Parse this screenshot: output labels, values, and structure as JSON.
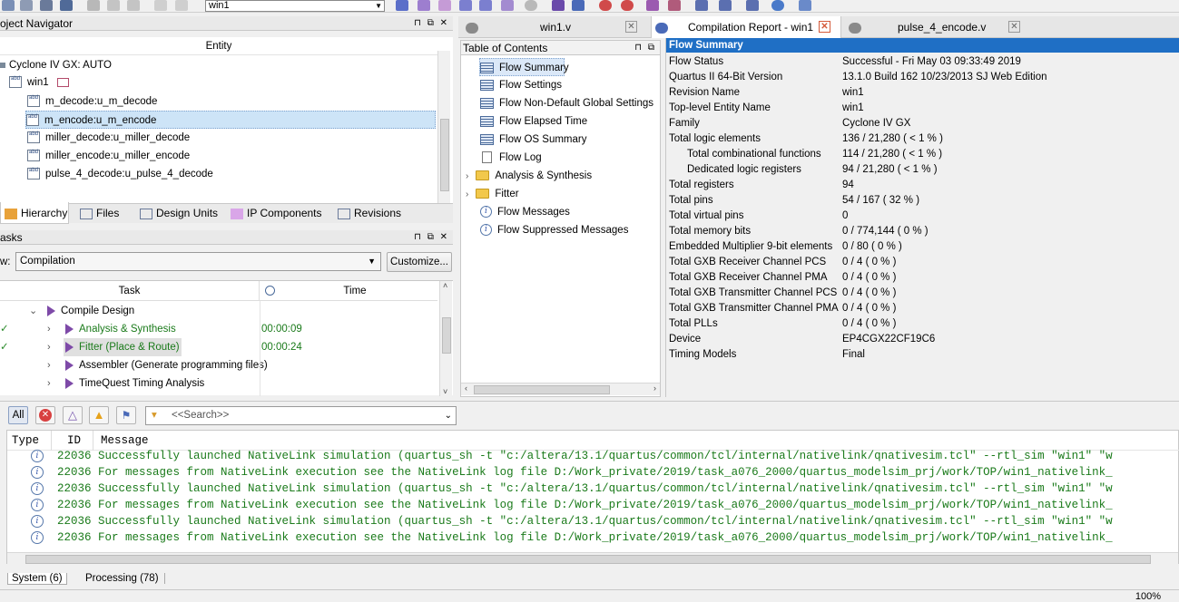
{
  "toolbar": {
    "revision_combo": "win1"
  },
  "project_navigator": {
    "title": "oject Navigator",
    "column_entity": "Entity",
    "device": "Cyclone IV GX: AUTO",
    "top_entity": "win1",
    "items": [
      {
        "label": "m_decode:u_m_decode"
      },
      {
        "label": "m_encode:u_m_encode"
      },
      {
        "label": "miller_decode:u_miller_decode"
      },
      {
        "label": "miller_encode:u_miller_encode"
      },
      {
        "label": "pulse_4_decode:u_pulse_4_decode"
      }
    ],
    "tabs": [
      "Hierarchy",
      "Files",
      "Design Units",
      "IP Components",
      "Revisions"
    ]
  },
  "tasks": {
    "title": "asks",
    "flow_label": "w:",
    "flow_value": "Compilation",
    "customize_label": "Customize...",
    "col_task": "Task",
    "col_time": "Time",
    "rows": [
      {
        "label": "Compile Design",
        "time": ""
      },
      {
        "label": "Analysis & Synthesis",
        "time": "00:00:09"
      },
      {
        "label": "Fitter (Place & Route)",
        "time": "00:00:24"
      },
      {
        "label": "Assembler (Generate programming files)",
        "time": ""
      },
      {
        "label": "TimeQuest Timing Analysis",
        "time": ""
      }
    ]
  },
  "editor_tabs": [
    {
      "label": "win1.v"
    },
    {
      "label": "Compilation Report - win1"
    },
    {
      "label": "pulse_4_encode.v"
    }
  ],
  "toc": {
    "title": "Table of Contents",
    "items": [
      {
        "label": "Flow Summary"
      },
      {
        "label": "Flow Settings"
      },
      {
        "label": "Flow Non-Default Global Settings"
      },
      {
        "label": "Flow Elapsed Time"
      },
      {
        "label": "Flow OS Summary"
      },
      {
        "label": "Flow Log"
      },
      {
        "label": "Analysis & Synthesis"
      },
      {
        "label": "Fitter"
      },
      {
        "label": "Flow Messages"
      },
      {
        "label": "Flow Suppressed Messages"
      }
    ]
  },
  "flow_summary": {
    "title": "Flow Summary",
    "rows": [
      {
        "key": "Flow Status",
        "value": "Successful - Fri May 03 09:33:49 2019"
      },
      {
        "key": "Quartus II 64-Bit Version",
        "value": "13.1.0 Build 162 10/23/2013 SJ Web Edition"
      },
      {
        "key": "Revision Name",
        "value": "win1"
      },
      {
        "key": "Top-level Entity Name",
        "value": "win1"
      },
      {
        "key": "Family",
        "value": "Cyclone IV GX"
      },
      {
        "key": "Total logic elements",
        "value": "136 / 21,280 ( < 1 % )"
      },
      {
        "key": "Total combinational functions",
        "value": "114 / 21,280 ( < 1 % )"
      },
      {
        "key": "Dedicated logic registers",
        "value": "94 / 21,280 ( < 1 % )"
      },
      {
        "key": "Total registers",
        "value": "94"
      },
      {
        "key": "Total pins",
        "value": "54 / 167 ( 32 % )"
      },
      {
        "key": "Total virtual pins",
        "value": "0"
      },
      {
        "key": "Total memory bits",
        "value": "0 / 774,144 ( 0 % )"
      },
      {
        "key": "Embedded Multiplier 9-bit elements",
        "value": "0 / 80 ( 0 % )"
      },
      {
        "key": "Total GXB Receiver Channel PCS",
        "value": "0 / 4 ( 0 % )"
      },
      {
        "key": "Total GXB Receiver Channel PMA",
        "value": "0 / 4 ( 0 % )"
      },
      {
        "key": "Total GXB Transmitter Channel PCS",
        "value": "0 / 4 ( 0 % )"
      },
      {
        "key": "Total GXB Transmitter Channel PMA",
        "value": "0 / 4 ( 0 % )"
      },
      {
        "key": "Total PLLs",
        "value": "0 / 4 ( 0 % )"
      },
      {
        "key": "Device",
        "value": "EP4CGX22CF19C6"
      },
      {
        "key": "Timing Models",
        "value": "Final"
      }
    ]
  },
  "messages": {
    "filter_all": "All",
    "search_placeholder": "<<Search>>",
    "col_type": "Type",
    "col_id": "ID",
    "col_message": "Message",
    "rows": [
      {
        "id": "22036",
        "text": "Successfully launched NativeLink simulation (quartus_sh -t \"c:/altera/13.1/quartus/common/tcl/internal/nativelink/qnativesim.tcl\" --rtl_sim \"win1\" \"w"
      },
      {
        "id": "22036",
        "text": "For messages from NativeLink execution see the NativeLink log file D:/Work_private/2019/task_a076_2000/quartus_modelsim_prj/work/TOP/win1_nativelink_"
      },
      {
        "id": "22036",
        "text": "Successfully launched NativeLink simulation (quartus_sh -t \"c:/altera/13.1/quartus/common/tcl/internal/nativelink/qnativesim.tcl\" --rtl_sim \"win1\" \"w"
      },
      {
        "id": "22036",
        "text": "For messages from NativeLink execution see the NativeLink log file D:/Work_private/2019/task_a076_2000/quartus_modelsim_prj/work/TOP/win1_nativelink_"
      },
      {
        "id": "22036",
        "text": "Successfully launched NativeLink simulation (quartus_sh -t \"c:/altera/13.1/quartus/common/tcl/internal/nativelink/qnativesim.tcl\" --rtl_sim \"win1\" \"w"
      },
      {
        "id": "22036",
        "text": "For messages from NativeLink execution see the NativeLink log file D:/Work_private/2019/task_a076_2000/quartus_modelsim_prj/work/TOP/win1_nativelink_"
      }
    ],
    "tabs": [
      "System (6)",
      "Processing (78)"
    ]
  },
  "status_bar": {
    "progress": "100%"
  }
}
